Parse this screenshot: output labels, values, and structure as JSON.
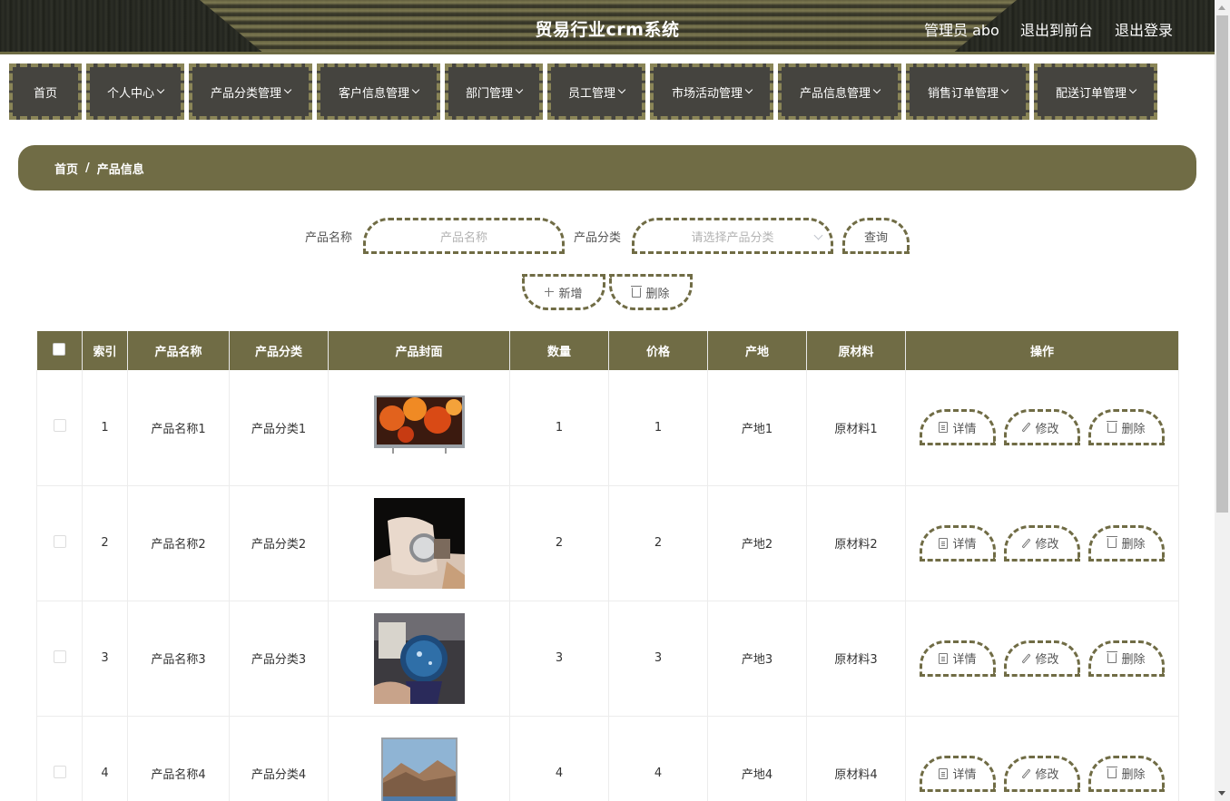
{
  "header": {
    "title": "贸易行业crm系统",
    "user": "管理员 abo",
    "to_front": "退出到前台",
    "logout": "退出登录"
  },
  "nav": {
    "items": [
      {
        "label": "首页",
        "has_menu": false
      },
      {
        "label": "个人中心",
        "has_menu": true
      },
      {
        "label": "产品分类管理",
        "has_menu": true
      },
      {
        "label": "客户信息管理",
        "has_menu": true
      },
      {
        "label": "部门管理",
        "has_menu": true
      },
      {
        "label": "员工管理",
        "has_menu": true
      },
      {
        "label": "市场活动管理",
        "has_menu": true
      },
      {
        "label": "产品信息管理",
        "has_menu": true
      },
      {
        "label": "销售订单管理",
        "has_menu": true
      },
      {
        "label": "配送订单管理",
        "has_menu": true
      }
    ]
  },
  "breadcrumb": {
    "home": "首页",
    "sep": "/",
    "current": "产品信息"
  },
  "search": {
    "name_label": "产品名称",
    "name_placeholder": "产品名称",
    "category_label": "产品分类",
    "category_placeholder": "请选择产品分类",
    "query_button": "查询"
  },
  "actions": {
    "add": "新增",
    "delete": "删除"
  },
  "table": {
    "headers": [
      "索引",
      "产品名称",
      "产品分类",
      "产品封面",
      "数量",
      "价格",
      "产地",
      "原材料",
      "操作"
    ],
    "op_labels": {
      "detail": "详情",
      "edit": "修改",
      "delete": "删除"
    },
    "rows": [
      {
        "index": "1",
        "name": "产品名称1",
        "category": "产品分类1",
        "cover": "tv-flowers",
        "qty": "1",
        "price": "1",
        "origin": "产地1",
        "material": "原材料1"
      },
      {
        "index": "2",
        "name": "产品名称2",
        "category": "产品分类2",
        "cover": "wrist-watch",
        "qty": "2",
        "price": "2",
        "origin": "产地2",
        "material": "原材料2"
      },
      {
        "index": "3",
        "name": "产品名称3",
        "category": "产品分类3",
        "cover": "blue-watch",
        "qty": "3",
        "price": "3",
        "origin": "产地3",
        "material": "原材料3"
      },
      {
        "index": "4",
        "name": "产品名称4",
        "category": "产品分类4",
        "cover": "tv-mountains",
        "qty": "4",
        "price": "4",
        "origin": "产地4",
        "material": "原材料4"
      }
    ]
  },
  "colors": {
    "accent": "#706c45",
    "nav_bg": "#45443f",
    "header_bg": "#2b2b22"
  }
}
